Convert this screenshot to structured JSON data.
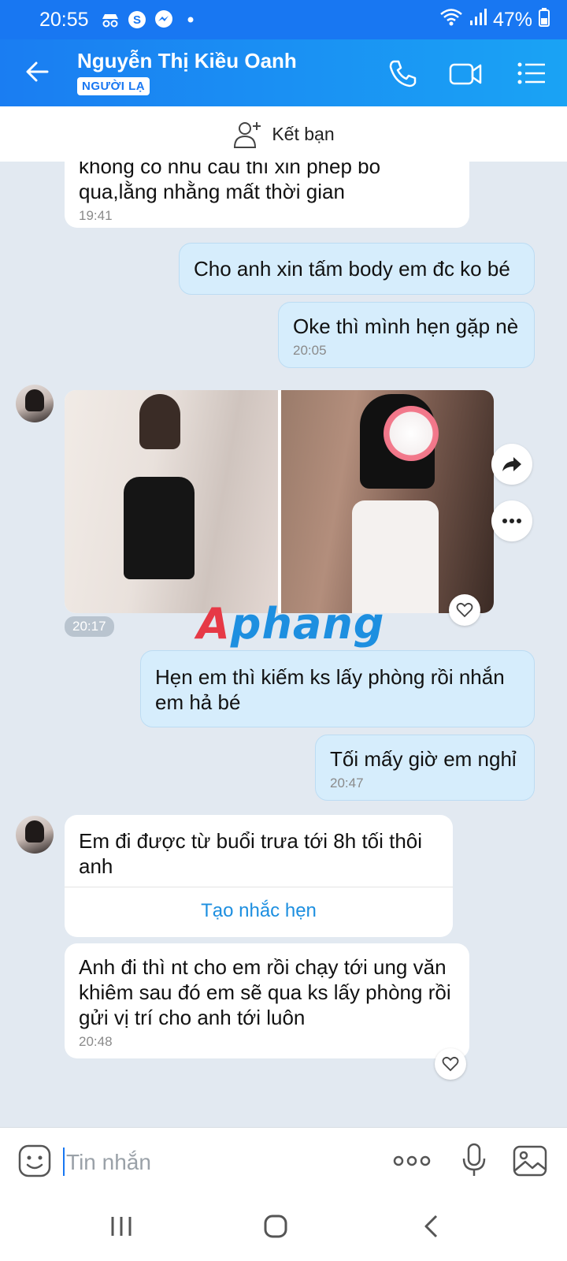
{
  "status": {
    "time": "20:55",
    "battery": "47%"
  },
  "header": {
    "contact_name": "Nguyễn Thị Kiều Oanh",
    "badge": "NGƯỜI LẠ"
  },
  "friend_bar": {
    "label": "Kết bạn"
  },
  "messages": [
    {
      "type": "in",
      "text": "không có nhu cầu thì xin phép bỏ qua,lằng nhằng mất thời gian",
      "time": "19:41"
    },
    {
      "type": "out",
      "text": "Cho anh xin tấm body em đc ko bé",
      "time": ""
    },
    {
      "type": "out",
      "text": "Oke thì mình hẹn gặp nè",
      "time": "20:05"
    },
    {
      "type": "in-photos",
      "time": "20:17"
    },
    {
      "type": "out",
      "text": "Hẹn em thì kiếm ks lấy phòng rồi nhắn em hả bé",
      "time": ""
    },
    {
      "type": "out",
      "text": "Tối mấy giờ em nghỉ",
      "time": "20:47"
    },
    {
      "type": "in",
      "text": "Em đi được từ buổi trưa tới 8h tối thôi anh",
      "action": "Tạo nhắc hẹn"
    },
    {
      "type": "in",
      "text": "Anh đi thì nt cho em rồi chạy tới ung văn khiêm sau đó em sẽ qua ks lấy phòng rồi gửi vị trí cho anh tới luôn",
      "time": "20:48"
    }
  ],
  "watermark": {
    "part1": "A",
    "part2": "phang"
  },
  "input": {
    "placeholder": "Tin nhắn"
  },
  "colors": {
    "header_blue": "#1877f2",
    "outgoing_bubble": "#d6edfc",
    "incoming_bubble": "#ffffff",
    "chat_bg": "#e2e9f1"
  }
}
